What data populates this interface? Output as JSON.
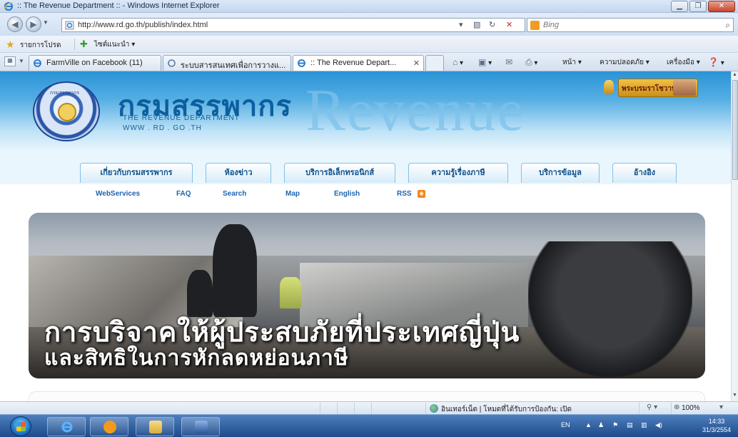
{
  "window": {
    "title": ":: The Revenue Department :: - Windows Internet Explorer"
  },
  "address_bar": {
    "url": "http://www.rd.go.th/publish/index.html",
    "search_placeholder": "Bing"
  },
  "favorites_bar": {
    "favorites_label": "รายการโปรด",
    "suggested_sites_label": "ไซต์แนะนำ ▾"
  },
  "tabs": [
    {
      "label": "FarmVille on Facebook (11)",
      "active": false
    },
    {
      "label": "ระบบสารสนเทศเพื่อการวางแ...",
      "active": false
    },
    {
      "label": ":: The Revenue Depart...",
      "active": true
    }
  ],
  "command_bar": {
    "page_label": "หน้า ▾",
    "safety_label": "ความปลอดภัย ▾",
    "tools_label": "เครื่องมือ ▾"
  },
  "site": {
    "header": {
      "dept_name_thai": "กรมสรรพากร",
      "dept_name_en": "THE REVENUE DEPARTMENT",
      "website": "WWW . RD . GO .TH",
      "background_word": "Revenue",
      "royal_banner_text": "พระบรมราโชวาท",
      "seal_text": "กรมสรรพากร"
    },
    "main_menu": [
      "เกี่ยวกับกรมสรรพากร",
      "ห้องข่าว",
      "บริการอิเล็กทรอนิกส์",
      "ความรู้เรื่องภาษี",
      "บริการข้อมูล",
      "อ้างอิง"
    ],
    "sub_links": [
      "WebServices",
      "FAQ",
      "Search",
      "Map",
      "English",
      "RSS"
    ],
    "hero": {
      "headline_line1": "การบริจาคให้ผู้ประสบภัยที่ประเทศญี่ปุ่น",
      "headline_line2": "และสิทธิในการหักลดหย่อนภาษี"
    }
  },
  "status_bar": {
    "zone_text": "อินเทอร์เน็ต | โหมดที่ได้รับการป้องกัน: เปิด",
    "zoom": "100%"
  },
  "taskbar": {
    "language": "EN",
    "time": "14:33",
    "date": "31/3/2554"
  },
  "colors": {
    "header_blue": "#2a93d6",
    "menu_text": "#0d4f8a",
    "link_blue": "#1e64b0",
    "rss_orange": "#f08a1c"
  }
}
